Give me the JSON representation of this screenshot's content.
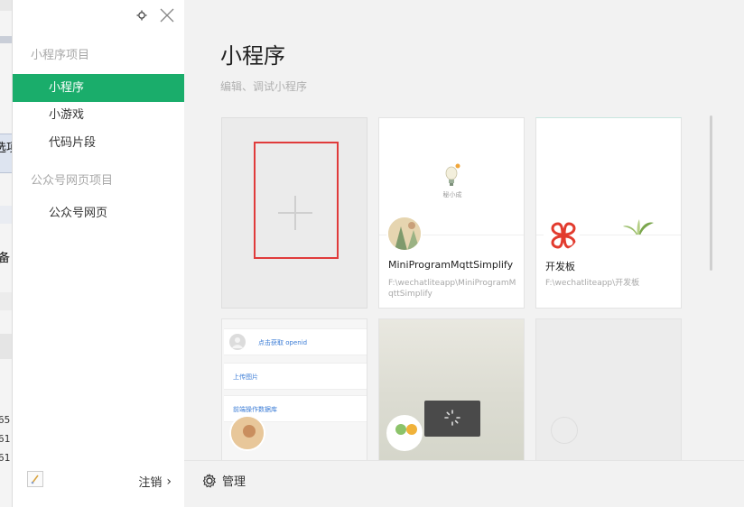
{
  "sidebar": {
    "sections": [
      {
        "title": "小程序项目",
        "items": [
          {
            "label": "小程序",
            "active": true
          },
          {
            "label": "小游戏"
          },
          {
            "label": "代码片段"
          }
        ]
      },
      {
        "title": "公众号网页项目",
        "items": [
          {
            "label": "公众号网页"
          }
        ]
      }
    ],
    "logout_label": "注销",
    "logout_arrow": "›"
  },
  "main": {
    "title": "小程序",
    "subtitle": "编辑、调试小程序",
    "projects": [
      {
        "name": "MiniProgramMqttSimplify",
        "path": "F:\\wechatliteapp\\MiniProgramMqttSimplify",
        "thumb_label": "秘小成"
      },
      {
        "name": "开发板",
        "path": "F:\\wechatliteapp\\开发板"
      }
    ],
    "preview_rows": [
      "点击获取 openid",
      "上传图片",
      "前端操作数据库"
    ]
  },
  "bottom": {
    "manage_label": "管理"
  },
  "background_window": {
    "texts": [
      "选项",
      "备"
    ],
    "numbers": [
      "65",
      "61",
      "61"
    ]
  },
  "colors": {
    "accent": "#1aad6b",
    "highlight_box": "#e03b3b",
    "link": "#3b7cd6"
  },
  "icons": [
    "gear-icon",
    "close-icon",
    "plus-icon",
    "clover-logo-icon",
    "chevron-right-icon"
  ]
}
